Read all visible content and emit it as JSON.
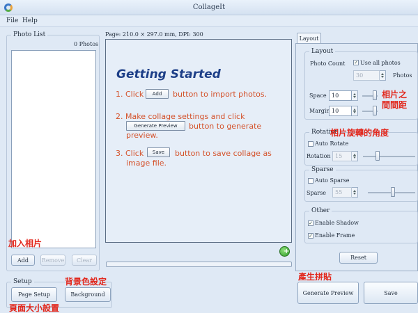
{
  "window": {
    "title": "CollageIt"
  },
  "menu": {
    "file": "File",
    "help": "Help"
  },
  "photo_list": {
    "label": "Photo List",
    "count": "0 Photos",
    "add": "Add",
    "remove": "Remove",
    "clear": "Clear"
  },
  "page_info": "Page: 210.0 × 297.0 mm, DPI: 300",
  "getting_started": {
    "title": "Getting Started",
    "step1_pre": "1. Click",
    "step1_btn": "Add",
    "step1_post": "button to import photos.",
    "step2_line1": "2. Make collage settings and click",
    "step2_btn": "Generate Preview",
    "step2_post": "button to generate",
    "step2_line3": "preview.",
    "step3_pre": "3. Click",
    "step3_btn": "Save",
    "step3_post": "button to save collage as",
    "step3_line2": "image file."
  },
  "setup": {
    "label": "Setup",
    "page_setup": "Page Setup",
    "background": "Background"
  },
  "tab": "Layout",
  "layout": {
    "label": "Layout",
    "photo_count": "Photo Count",
    "use_all": "Use all photos",
    "count_value": "30",
    "photos": "Photos",
    "space_label": "Space",
    "space_value": "10",
    "margin_label": "Margin",
    "margin_value": "10"
  },
  "rotation": {
    "label": "Rotation",
    "auto": "Auto Rotate",
    "field": "Rotation",
    "value": "15"
  },
  "sparse": {
    "label": "Sparse",
    "auto": "Auto Sparse",
    "field": "Sparse",
    "value": "55"
  },
  "other": {
    "label": "Other",
    "shadow": "Enable Shadow",
    "frame": "Enable Frame"
  },
  "reset": "Reset",
  "generate_preview": "Generate Preview",
  "save": "Save",
  "annotations": {
    "spacing_1": "相片之",
    "spacing_2": "間間距",
    "rotation": "相片旋轉的角度",
    "add_photos": "加入相片",
    "background": "背景色設定",
    "page_size": "頁面大小設置",
    "generate": "產生拼貼"
  },
  "colors": {
    "accent": "#1d3f88",
    "instruction": "#d4512a",
    "annotation": "#e2271c"
  }
}
